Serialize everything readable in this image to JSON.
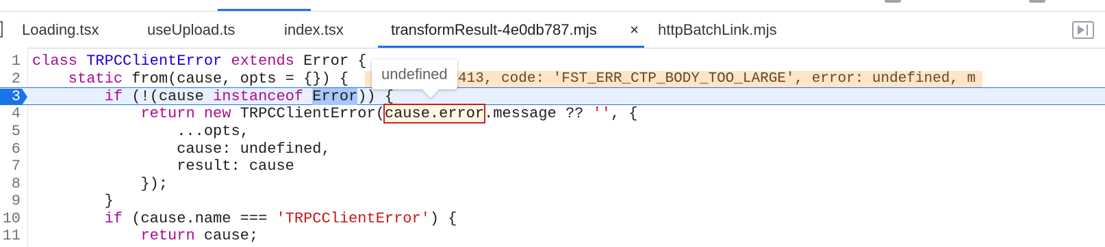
{
  "tabs": [
    {
      "label": "Loading.tsx",
      "active": false
    },
    {
      "label": "useUpload.ts",
      "active": false
    },
    {
      "label": "index.tsx",
      "active": false
    },
    {
      "label": "transformResult-4e0db787.mjs",
      "active": true,
      "close": "×"
    },
    {
      "label": "httpBatchLink.mjs",
      "active": false
    }
  ],
  "tooltip": {
    "text": "undefined"
  },
  "code": {
    "current_line": 3,
    "lines": [
      {
        "n": "1"
      },
      {
        "n": "2",
        "inline_value": "atusCode: 413, code: 'FST_ERR_CTP_BODY_TOO_LARGE', error: undefined, m"
      },
      {
        "n": "3"
      },
      {
        "n": "4"
      },
      {
        "n": "5"
      },
      {
        "n": "6"
      },
      {
        "n": "7"
      },
      {
        "n": "8"
      },
      {
        "n": "9"
      },
      {
        "n": "10"
      },
      {
        "n": "11"
      }
    ],
    "tokens": {
      "l1": [
        "class",
        " TRPCClientError ",
        "extends",
        " Error {"
      ],
      "l2": [
        "    static ",
        "from",
        "(cause, opts = {}) {"
      ],
      "l3": [
        "        ",
        "if",
        " (!(cause ",
        "instanceof",
        " ",
        "Error",
        ")) {"
      ],
      "l4": [
        "            ",
        "return",
        " ",
        "new",
        " TRPCClientError(",
        "cause.error",
        ".message ?? ",
        "''",
        ", {"
      ],
      "l5": [
        "                ...opts,"
      ],
      "l6": [
        "                cause: undefined,"
      ],
      "l7": [
        "                result: cause"
      ],
      "l8": [
        "            });"
      ],
      "l9": [
        "        }"
      ],
      "l10": [
        "        ",
        "if",
        " (cause.name === ",
        "'TRPCClientError'",
        ") {"
      ],
      "l11": [
        "            ",
        "return",
        " cause;"
      ]
    }
  },
  "colors": {
    "accent": "#1a73e8",
    "keyword": "#aa0d91",
    "string": "#c41a16",
    "inline_value_bg": "#fde5c8"
  }
}
